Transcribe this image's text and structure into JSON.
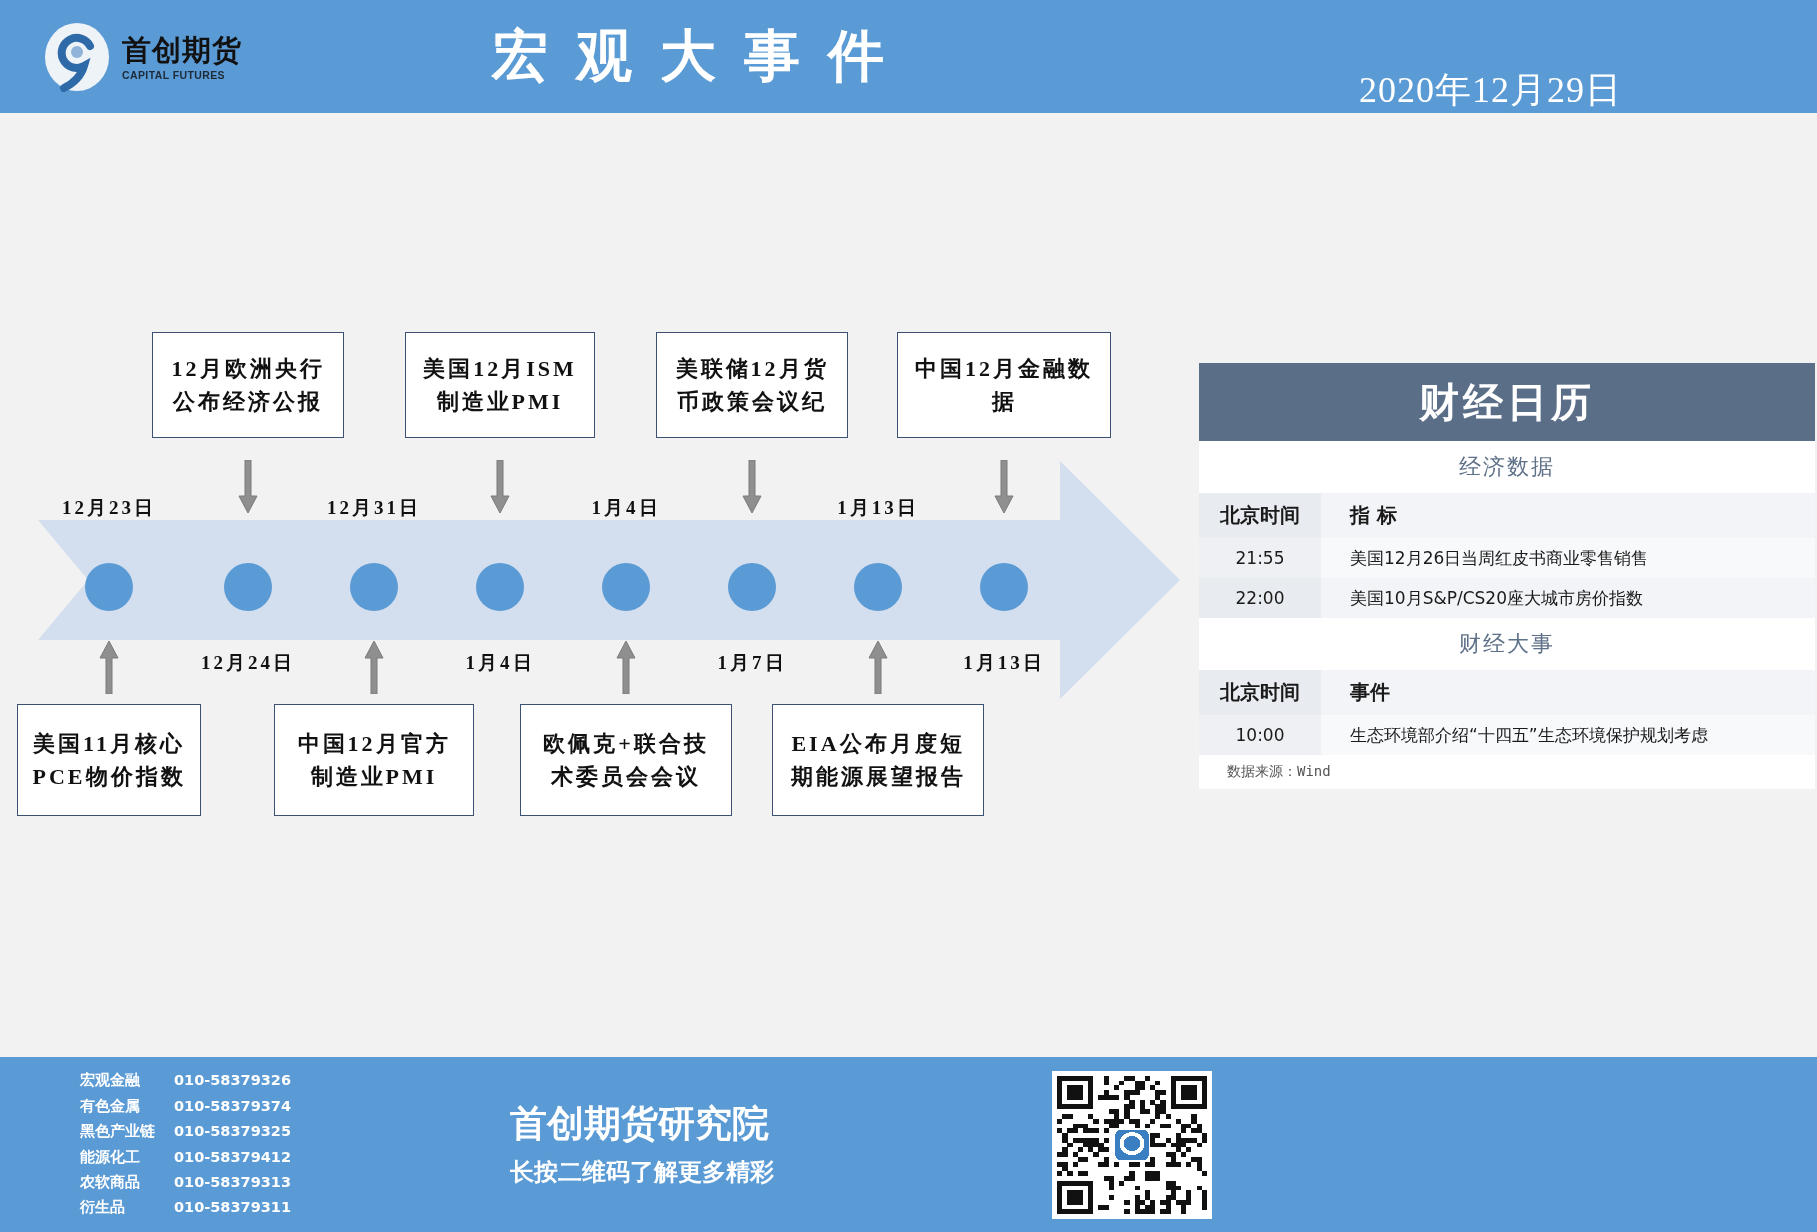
{
  "header": {
    "brand": {
      "name": "首创期货",
      "subtitle": "CAPITAL FUTURES"
    },
    "title": "宏观大事件",
    "date": "2020年12月29日"
  },
  "timeline": {
    "events": [
      {
        "date": "12月23日",
        "event": "美国11月核心PCE物价指数",
        "kind": "below"
      },
      {
        "date": "12月24日",
        "event": "12月欧洲央行公布经济公报",
        "kind": "above"
      },
      {
        "date": "12月31日",
        "event": "中国12月官方制造业PMI",
        "kind": "below"
      },
      {
        "date": "1月4日",
        "event": "美国12月ISM制造业PMI",
        "kind": "above"
      },
      {
        "date": "1月4日",
        "event": "欧佩克+联合技术委员会会议",
        "kind": "below"
      },
      {
        "date": "1月7日",
        "event": "美联储12月货币政策会议纪",
        "kind": "above"
      },
      {
        "date": "1月13日",
        "event": "EIA公布月度短期能源展望报告",
        "kind": "below"
      },
      {
        "date": "1月13日",
        "event": "中国12月金融数据",
        "kind": "above"
      }
    ]
  },
  "calendar": {
    "title": "财经日历",
    "sections": [
      {
        "title": "经济数据",
        "columns": [
          "北京时间",
          "指 标"
        ],
        "rows": [
          [
            "21:55",
            "美国12月26日当周红皮书商业零售销售"
          ],
          [
            "22:00",
            "美国10月S&P/CS20座大城市房价指数"
          ]
        ]
      },
      {
        "title": "财经大事",
        "columns": [
          "北京时间",
          "事件"
        ],
        "rows": [
          [
            "10:00",
            "生态环境部介绍“十四五”生态环境保护规划考虑"
          ]
        ]
      }
    ],
    "source": "数据来源：Wind"
  },
  "footer": {
    "contacts": [
      {
        "department": "宏观金融",
        "phone": "010-58379326"
      },
      {
        "department": "有色金属",
        "phone": "010-58379374"
      },
      {
        "department": "黑色产业链",
        "phone": "010-58379325"
      },
      {
        "department": "能源化工",
        "phone": "010-58379412"
      },
      {
        "department": "农软商品",
        "phone": "010-58379313"
      },
      {
        "department": "衍生品",
        "phone": "010-58379311"
      }
    ],
    "title": "首创期货研究院",
    "subtitle": "长按二维码了解更多精彩"
  }
}
